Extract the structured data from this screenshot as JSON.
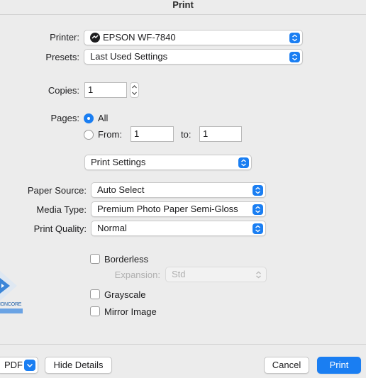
{
  "window": {
    "title": "Print"
  },
  "printer": {
    "label": "Printer:",
    "value": "EPSON WF-7840",
    "icon": "printer-network-icon"
  },
  "presets": {
    "label": "Presets:",
    "value": "Last Used Settings"
  },
  "copies": {
    "label": "Copies:",
    "value": "1"
  },
  "pages": {
    "label": "Pages:",
    "all_label": "All",
    "from_label": "From:",
    "from_value": "1",
    "to_label": "to:",
    "to_value": "1",
    "selected": "All"
  },
  "section": {
    "value": "Print Settings"
  },
  "paper_source": {
    "label": "Paper Source:",
    "value": "Auto Select"
  },
  "media_type": {
    "label": "Media Type:",
    "value": "Premium Photo Paper Semi-Gloss"
  },
  "print_quality": {
    "label": "Print Quality:",
    "value": "Normal"
  },
  "borderless": {
    "label": "Borderless",
    "checked": false
  },
  "expansion": {
    "label": "Expansion:",
    "value": "Std",
    "enabled": false
  },
  "grayscale": {
    "label": "Grayscale",
    "checked": false
  },
  "mirror": {
    "label": "Mirror Image",
    "checked": false
  },
  "badge": {
    "text": "IONCORE"
  },
  "footer": {
    "pdf_label": "PDF",
    "hide_details_label": "Hide Details",
    "cancel_label": "Cancel",
    "print_label": "Print"
  },
  "colors": {
    "accent": "#1a7ef2",
    "background": "#ececec"
  }
}
